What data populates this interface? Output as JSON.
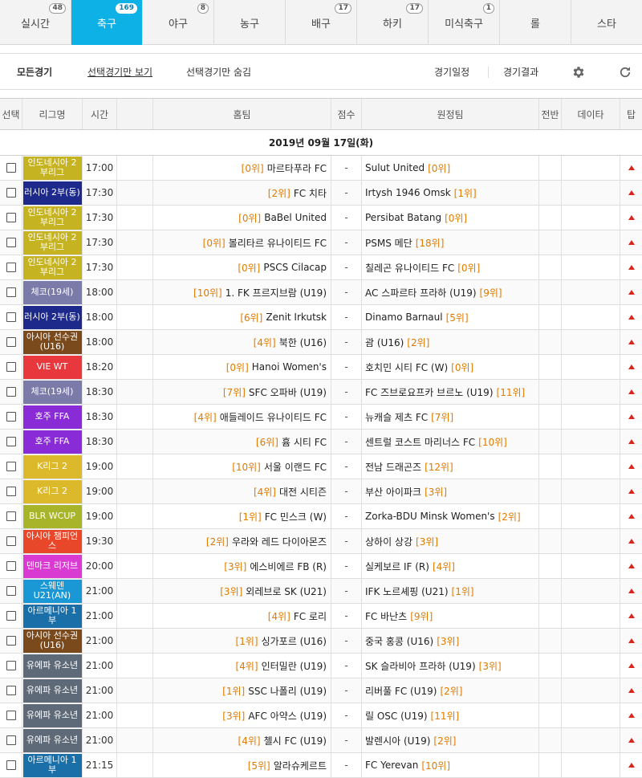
{
  "tabs": [
    {
      "label": "실시간",
      "badge": "48",
      "active": false
    },
    {
      "label": "축구",
      "badge": "169",
      "active": true
    },
    {
      "label": "야구",
      "badge": "8",
      "active": false
    },
    {
      "label": "농구",
      "badge": "",
      "active": false
    },
    {
      "label": "배구",
      "badge": "17",
      "active": false
    },
    {
      "label": "하키",
      "badge": "17",
      "active": false
    },
    {
      "label": "미식축구",
      "badge": "1",
      "active": false
    },
    {
      "label": "롤",
      "badge": "",
      "active": false
    },
    {
      "label": "스타",
      "badge": "",
      "active": false
    }
  ],
  "filter": {
    "all": "모든경기",
    "show_selected": "선택경기만 보기",
    "hide_selected": "선택경기만 숨김",
    "schedule": "경기일정",
    "results": "경기결과",
    "settings_icon": "gear-icon",
    "refresh_icon": "refresh-icon"
  },
  "columns": {
    "select": "선택",
    "league": "리그명",
    "time": "시간",
    "home": "홈팀",
    "score": "점수",
    "away": "원정팀",
    "half": "전반",
    "data": "데이타",
    "tip": "탑"
  },
  "date_label": "2019년 09월 17일(화)",
  "score_placeholder": "-",
  "colors": {
    "accent": "#0eb1e6",
    "rank": "#e07b00",
    "tip_arrow": "#d9261c"
  },
  "matches": [
    {
      "league": "인도네시아 2부리그",
      "league_color": "#c6b322",
      "time": "17:00",
      "home_rank": "[0위]",
      "home": "마르타푸라 FC",
      "away": "Sulut United",
      "away_rank": "[0위]"
    },
    {
      "league": "러시아 2부(동)",
      "league_color": "#1d2a8c",
      "time": "17:30",
      "home_rank": "[2위]",
      "home": "FC 치타",
      "away": "Irtysh 1946 Omsk",
      "away_rank": "[1위]"
    },
    {
      "league": "인도네시아 2부리그",
      "league_color": "#c6b322",
      "time": "17:30",
      "home_rank": "[0위]",
      "home": "BaBel United",
      "away": "Persibat Batang",
      "away_rank": "[0위]"
    },
    {
      "league": "인도네시아 2부리그",
      "league_color": "#c6b322",
      "time": "17:30",
      "home_rank": "[0위]",
      "home": "볼리타르 유나이티드 FC",
      "away": "PSMS 메단",
      "away_rank": "[18위]"
    },
    {
      "league": "인도네시아 2부리그",
      "league_color": "#c6b322",
      "time": "17:30",
      "home_rank": "[0위]",
      "home": "PSCS Cilacap",
      "away": "칠레곤 유나이티드 FC",
      "away_rank": "[0위]"
    },
    {
      "league": "체코(19세)",
      "league_color": "#7a7ba8",
      "time": "18:00",
      "home_rank": "[10위]",
      "home": "1. FK 프르지브람 (U19)",
      "away": "AC 스파르타 프라하 (U19)",
      "away_rank": "[9위]"
    },
    {
      "league": "러시아 2부(동)",
      "league_color": "#1d2a8c",
      "time": "18:00",
      "home_rank": "[6위]",
      "home": "Zenit Irkutsk",
      "away": "Dinamo Barnaul",
      "away_rank": "[5위]"
    },
    {
      "league": "아시아 선수권 (U16)",
      "league_color": "#7a4a1c",
      "time": "18:00",
      "home_rank": "[4위]",
      "home": "북한 (U16)",
      "away": "괌 (U16)",
      "away_rank": "[2위]"
    },
    {
      "league": "VIE WT",
      "league_color": "#e8383d",
      "time": "18:20",
      "home_rank": "[0위]",
      "home": "Hanoi Women's",
      "away": "호치민 시티 FC (W)",
      "away_rank": "[0위]"
    },
    {
      "league": "체코(19세)",
      "league_color": "#7a7ba8",
      "time": "18:30",
      "home_rank": "[7위]",
      "home": "SFC 오파바 (U19)",
      "away": "FC 즈브로요프카 브르노 (U19)",
      "away_rank": "[11위]"
    },
    {
      "league": "호주 FFA",
      "league_color": "#8a2bd8",
      "time": "18:30",
      "home_rank": "[4위]",
      "home": "애들레이드 유나이티드 FC",
      "away": "뉴캐슬 제츠 FC",
      "away_rank": "[7위]"
    },
    {
      "league": "호주 FFA",
      "league_color": "#8a2bd8",
      "time": "18:30",
      "home_rank": "[6위]",
      "home": "흄 시티 FC",
      "away": "센트럴 코스트 마리너스 FC",
      "away_rank": "[10위]"
    },
    {
      "league": "K리그 2",
      "league_color": "#dcb92a",
      "time": "19:00",
      "home_rank": "[10위]",
      "home": "서울 이랜드 FC",
      "away": "전남 드래곤즈",
      "away_rank": "[12위]"
    },
    {
      "league": "K리그 2",
      "league_color": "#dcb92a",
      "time": "19:00",
      "home_rank": "[4위]",
      "home": "대전 시티즌",
      "away": "부산 아이파크",
      "away_rank": "[3위]"
    },
    {
      "league": "BLR WCUP",
      "league_color": "#a8b42a",
      "time": "19:00",
      "home_rank": "[1위]",
      "home": "FC 민스크 (W)",
      "away": "Zorka-BDU Minsk Women's",
      "away_rank": "[2위]"
    },
    {
      "league": "아시아 챔피언스",
      "league_color": "#e8472a",
      "time": "19:30",
      "home_rank": "[2위]",
      "home": "우라와 레드 다이아몬즈",
      "away": "상하이 상강",
      "away_rank": "[3위]"
    },
    {
      "league": "덴마크 리저브",
      "league_color": "#d93ad2",
      "time": "20:00",
      "home_rank": "[3위]",
      "home": "에스비에르 FB (R)",
      "away": "실케보르 IF (R)",
      "away_rank": "[4위]"
    },
    {
      "league": "스웨덴 U21(AN)",
      "league_color": "#1a98d6",
      "time": "21:00",
      "home_rank": "[3위]",
      "home": "외레브로 SK (U21)",
      "away": "IFK 노르셰핑 (U21)",
      "away_rank": "[1위]"
    },
    {
      "league": "아르메니아 1부",
      "league_color": "#1a6fa8",
      "time": "21:00",
      "home_rank": "[4위]",
      "home": "FC 로리",
      "away": "FC 바난츠",
      "away_rank": "[9위]"
    },
    {
      "league": "아시아 선수권 (U16)",
      "league_color": "#7a4a1c",
      "time": "21:00",
      "home_rank": "[1위]",
      "home": "싱가포르 (U16)",
      "away": "중국 홍콩 (U16)",
      "away_rank": "[3위]"
    },
    {
      "league": "유에파 유소년",
      "league_color": "#5f6a78",
      "time": "21:00",
      "home_rank": "[4위]",
      "home": "인터밀란 (U19)",
      "away": "SK 슬라비아 프라하 (U19)",
      "away_rank": "[3위]"
    },
    {
      "league": "유에파 유소년",
      "league_color": "#5f6a78",
      "time": "21:00",
      "home_rank": "[1위]",
      "home": "SSC 나폴리 (U19)",
      "away": "리버풀 FC (U19)",
      "away_rank": "[2위]"
    },
    {
      "league": "유에파 유소년",
      "league_color": "#5f6a78",
      "time": "21:00",
      "home_rank": "[3위]",
      "home": "AFC 아약스 (U19)",
      "away": "릴 OSC (U19)",
      "away_rank": "[11위]"
    },
    {
      "league": "유에파 유소년",
      "league_color": "#5f6a78",
      "time": "21:00",
      "home_rank": "[4위]",
      "home": "첼시 FC (U19)",
      "away": "발렌시아 (U19)",
      "away_rank": "[2위]"
    },
    {
      "league": "아르메니아 1부",
      "league_color": "#1a6fa8",
      "time": "21:15",
      "home_rank": "[5위]",
      "home": "알라슈케르트",
      "away": "FC Yerevan",
      "away_rank": "[10위]"
    }
  ]
}
